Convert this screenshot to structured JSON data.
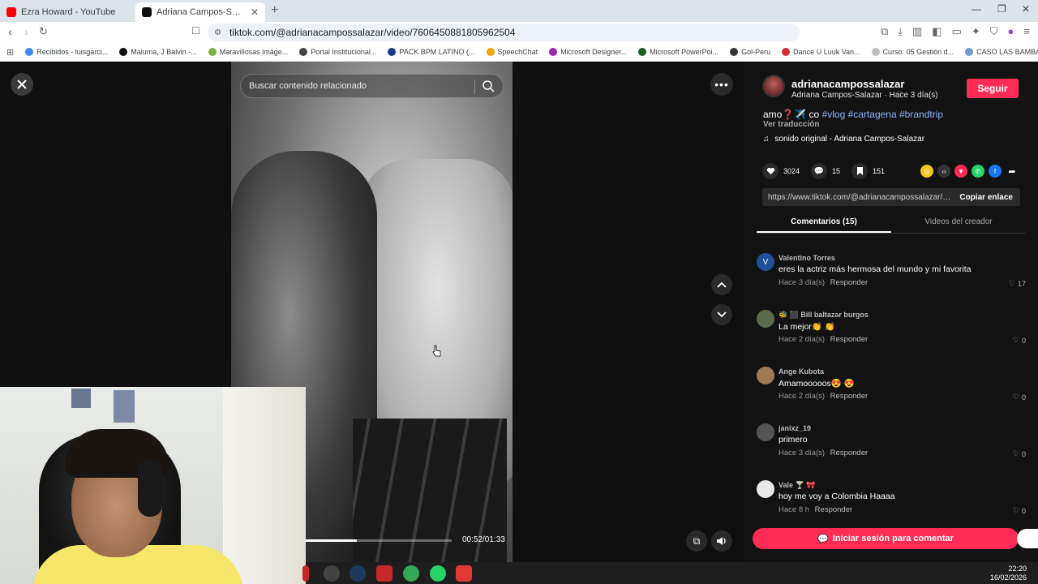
{
  "browser": {
    "tabs": [
      {
        "title": "Ezra Howard - YouTube",
        "active": false
      },
      {
        "title": "Adriana Campos-Salazar (@a",
        "active": true
      }
    ],
    "url": "tiktok.com/@adrianacampossalazar/video/7606450881805962504",
    "bookmarks": [
      {
        "label": "Recibidos - luisgarci...",
        "color": "#4285f4"
      },
      {
        "label": "Maluma, J Balvin -...",
        "color": "#111111"
      },
      {
        "label": "Maravillosas imáge...",
        "color": "#7cb342"
      },
      {
        "label": "Portal Institucional...",
        "color": "#444444"
      },
      {
        "label": "PACK BPM LATINO (...",
        "color": "#1a3a8a"
      },
      {
        "label": "SpeechChat",
        "color": "#f4a300"
      },
      {
        "label": "Microsoft Designer...",
        "color": "#9c27b0"
      },
      {
        "label": "Microsoft PowerPoi...",
        "color": "#1b5e20"
      },
      {
        "label": "Gol-Peru",
        "color": "#333333"
      },
      {
        "label": "Dance U Luuk Van...",
        "color": "#d32f2f"
      },
      {
        "label": "Curso: 05 Gestión d...",
        "color": "#bdbdbd"
      },
      {
        "label": "CASO LAS BAMBAS...",
        "color": "#6d9bd1"
      }
    ]
  },
  "video": {
    "search_placeholder": "Buscar contenido relacionado",
    "time": "00:52/01:33",
    "progress_fraction": 0.35
  },
  "author": {
    "username": "adrianacampossalazar",
    "subline": "Adriana Campos-Salazar · Hace 3 día(s)",
    "follow_label": "Seguir"
  },
  "caption": {
    "text_prefix": "amo❓✈️ co ",
    "tags": [
      "#vlog",
      "#cartagena",
      "#brandtrip"
    ],
    "translate": "Ver traducción",
    "sound": "sonido original - Adriana Campos-Salazar"
  },
  "stats": {
    "likes": "3024",
    "comments": "15",
    "saves": "151"
  },
  "link": {
    "url": "https://www.tiktok.com/@adrianacampossalazar/vi...",
    "copy_label": "Copiar enlace"
  },
  "tabs": {
    "comments": "Comentarios (15)",
    "creator": "Videos del creador"
  },
  "comments": [
    {
      "name": "Valentino Torres",
      "text": "eres la actriz más hermosa del mundo y mi favorita",
      "time": "Hace 3 día(s)",
      "reply": "Responder",
      "likes": "17",
      "avatar_letter": "V",
      "avatar_color": "#1e4f9a"
    },
    {
      "name": "🐝 ⬛ Bill baltazar burgos",
      "text": "La mejor👏 👏",
      "time": "Hace 2 día(s)",
      "reply": "Responder",
      "likes": "0",
      "avatar_letter": "",
      "avatar_color": "#5b6b4a"
    },
    {
      "name": "Ange Kubota",
      "text": "Amamooooos😍 😍",
      "time": "Hace 2 día(s)",
      "reply": "Responder",
      "likes": "0",
      "avatar_letter": "",
      "avatar_color": "#a07a55"
    },
    {
      "name": "janixz_19",
      "text": "primero",
      "time": "Hace 3 día(s)",
      "reply": "Responder",
      "likes": "0",
      "avatar_letter": "",
      "avatar_color": "#555555"
    },
    {
      "name": "Vale 🍸 🎀",
      "text": "hoy me voy a Colombia Haaaa",
      "time": "Hace 8 h",
      "reply": "Responder",
      "likes": "0",
      "avatar_letter": "",
      "avatar_color": "#e8e8e8"
    }
  ],
  "login_label": "Iniciar sesión para comentar",
  "taskbar": {
    "time": "22:20",
    "date": "16/02/2026"
  }
}
